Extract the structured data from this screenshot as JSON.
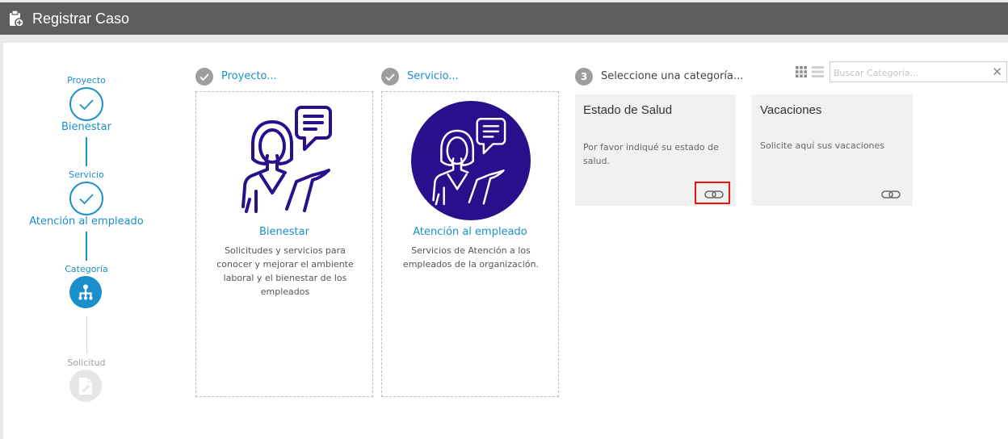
{
  "header": {
    "title": "Registrar Caso",
    "icon": "clipboard-plus-icon"
  },
  "stepper": {
    "steps": [
      {
        "label": "Proyecto",
        "value": "Bienestar",
        "state": "done"
      },
      {
        "label": "Servicio",
        "value": "Atención al empleado",
        "state": "done"
      },
      {
        "label": "Categoría",
        "value": "",
        "state": "active"
      },
      {
        "label": "Solicitud",
        "value": "",
        "state": "pending"
      }
    ]
  },
  "columns": [
    {
      "header": "Proyecto...",
      "name": "Bienestar",
      "description": "Solicitudes y servicios para conocer y mejorar el ambiente laboral y el bienestar de los empleados"
    },
    {
      "header": "Servicio...",
      "name": "Atención al empleado",
      "description": "Servicios de Atención a los empleados de la organización."
    }
  ],
  "category_step": {
    "number": "3",
    "header": "Seleccione una categoría..."
  },
  "search": {
    "placeholder": "Buscar Categoría..."
  },
  "categories": [
    {
      "name": "Estado de Salud",
      "description": "Por favor indiqué su estado de salud."
    },
    {
      "name": "Vacaciones",
      "description": "Solicite aquí sus vacaciones"
    }
  ],
  "colors": {
    "accent": "#1a8fc9",
    "topbar": "#5e5e5e",
    "illustration": "#2a0f8c",
    "highlight": "#e11111"
  }
}
